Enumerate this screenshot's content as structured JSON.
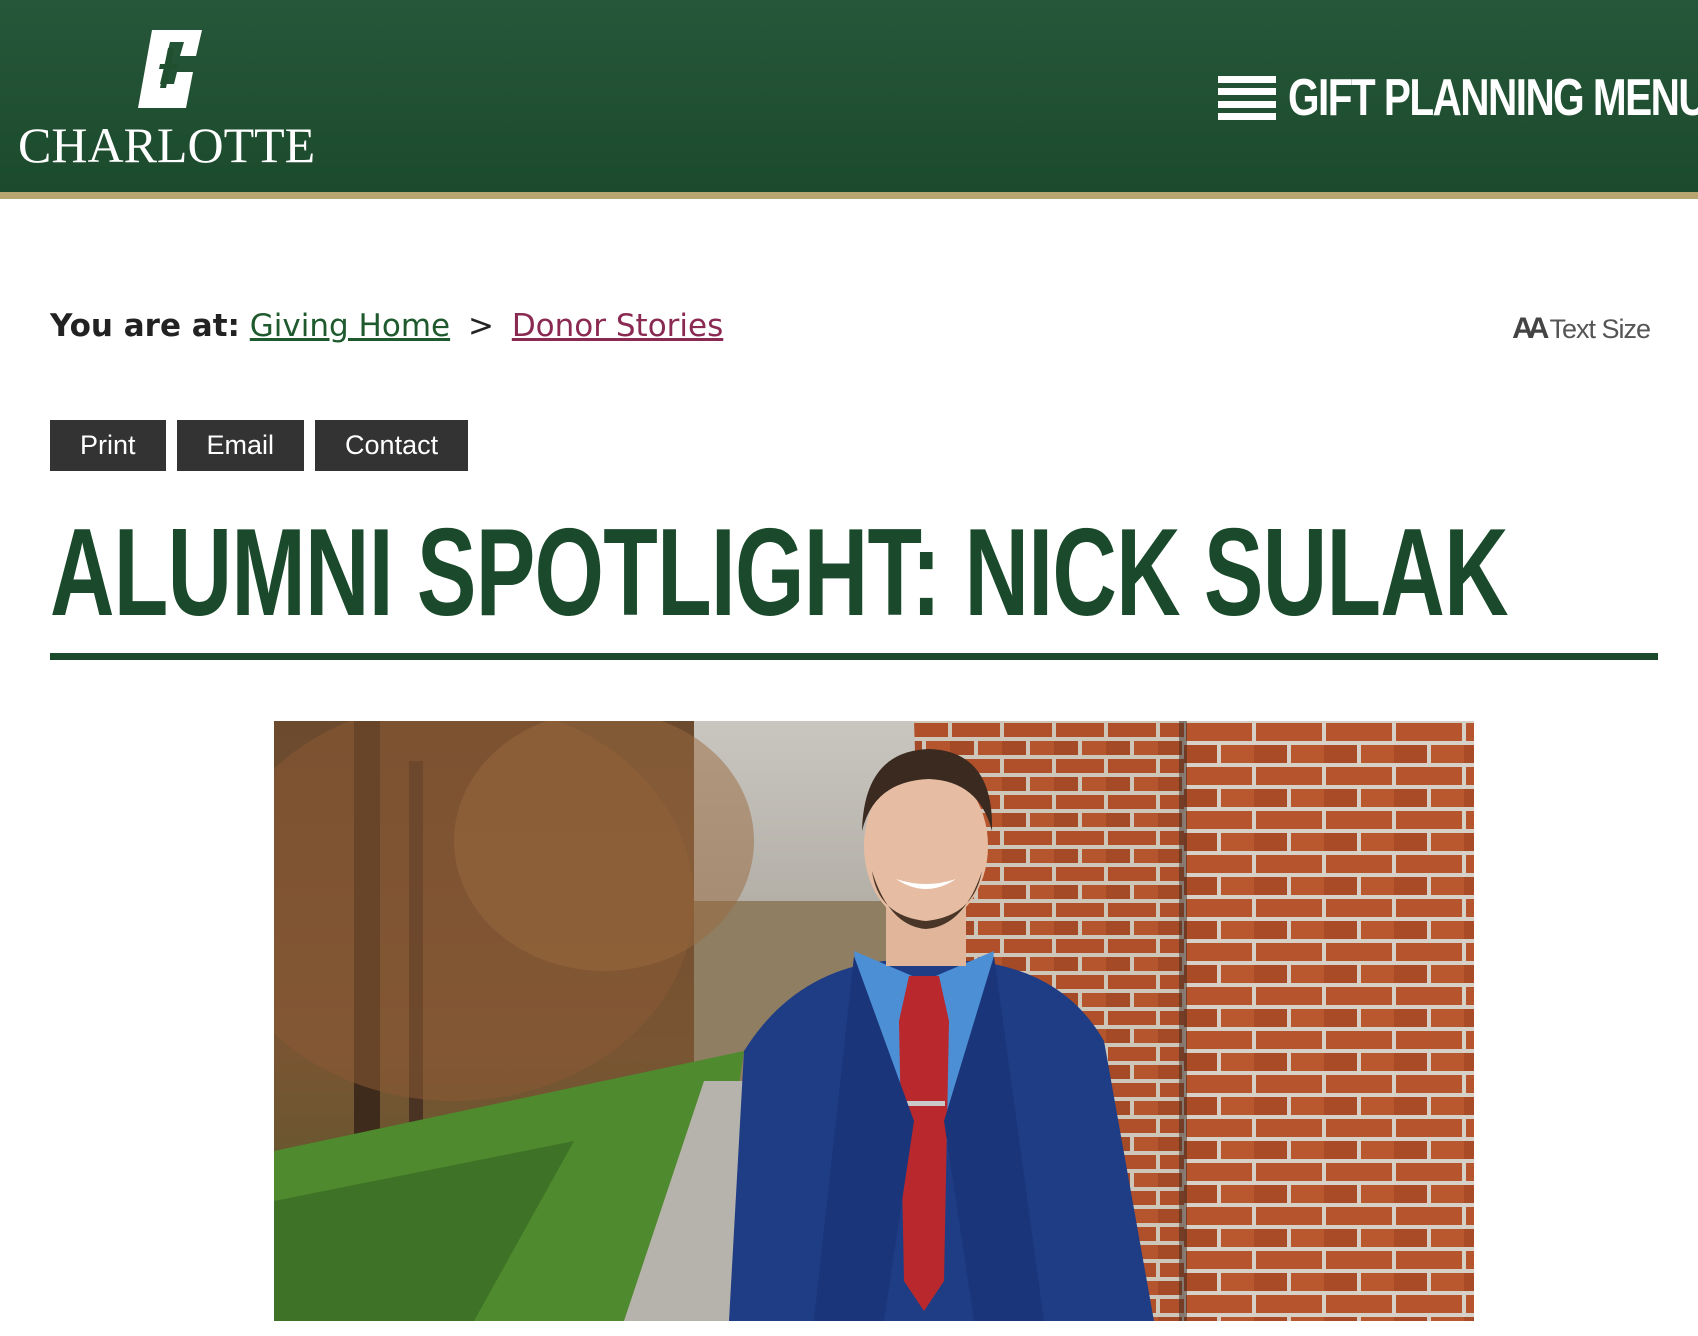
{
  "header": {
    "logo_text": "CHARLOTTE",
    "menu_label": "GIFT PLANNING MENU",
    "menu_icon": "hamburger-icon",
    "brand_green": "#1f4f2f",
    "accent_gold": "#b9a56f"
  },
  "breadcrumb": {
    "label": "You are at:",
    "items": [
      "Giving Home",
      "Donor Stories"
    ],
    "separator": ">"
  },
  "text_size": {
    "icon": "AA",
    "label": "Text Size"
  },
  "actions": [
    "Print",
    "Email",
    "Contact"
  ],
  "page": {
    "title": "ALUMNI SPOTLIGHT: NICK SULAK"
  }
}
